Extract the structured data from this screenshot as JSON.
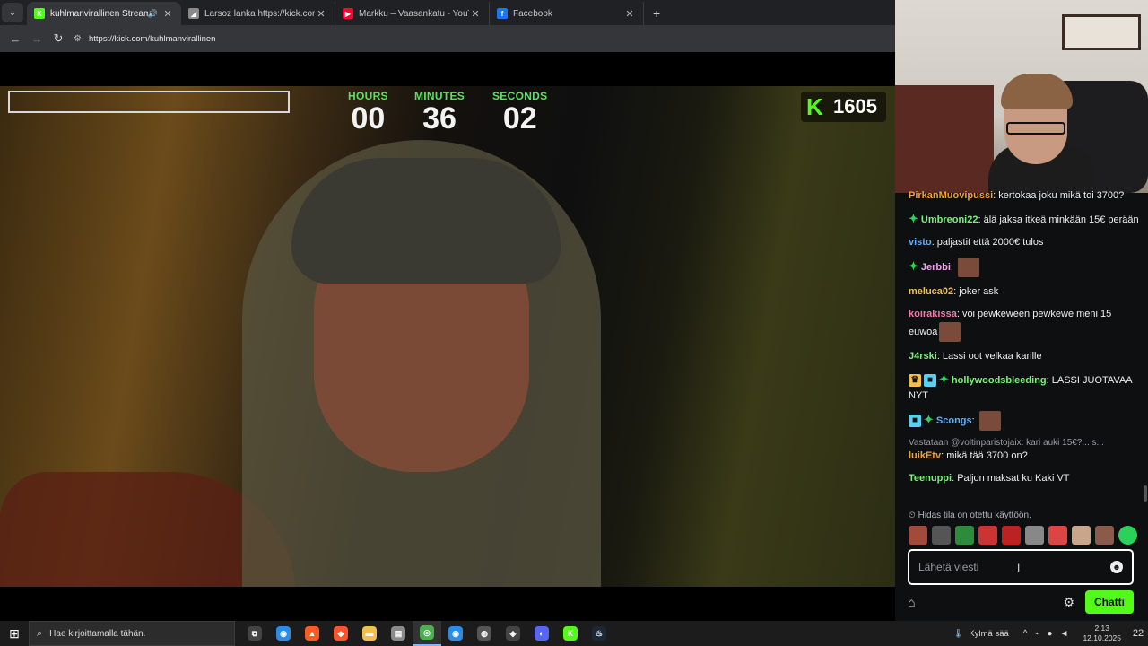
{
  "browser": {
    "tabs": [
      {
        "title": "kuhlmanvirallinen Stream -",
        "favicon": "K",
        "favicon_color": "#53fc18",
        "active": true,
        "has_audio": true
      },
      {
        "title": "Larsoz lanka https://kick.com/la",
        "favicon": "◢",
        "favicon_color": "#8a8a8a",
        "active": false,
        "has_audio": false
      },
      {
        "title": "Markku – Vaasankatu - YouTube",
        "favicon": "▶",
        "favicon_color": "#ff0033",
        "active": false,
        "has_audio": false
      },
      {
        "title": "Facebook",
        "favicon": "f",
        "favicon_color": "#1877f2",
        "active": false,
        "has_audio": false
      }
    ],
    "url": "https://kick.com/kuhlmanvirallinen"
  },
  "stream": {
    "timer": {
      "hours_label": "HOURS",
      "hours": "00",
      "minutes_label": "MINUTES",
      "minutes": "36",
      "seconds_label": "SECONDS",
      "seconds": "02"
    },
    "viewer_badge": {
      "logo": "K",
      "count": "1605"
    },
    "accent_color": "#53fc18"
  },
  "chat": {
    "messages": [
      {
        "user": "PirkanMuovipussi",
        "user_color": "#f2a134",
        "text": ": kertokaa joku mikä toi 3700?",
        "badges": [],
        "emote": false
      },
      {
        "user": "Umbreoni22",
        "user_color": "#7cf07c",
        "text": ": älä jaksa itkeä minkään 15€ perään",
        "badges": [
          "star"
        ],
        "emote": false
      },
      {
        "user": "visto",
        "user_color": "#5ab0ff",
        "text": ": paljastit että 2000€ tulos",
        "badges": [],
        "emote": false
      },
      {
        "user": "Jerbbi",
        "user_color": "#f2a0f0",
        "text": ": ",
        "badges": [
          "star"
        ],
        "emote": true
      },
      {
        "user": "meluca02",
        "user_color": "#f2c04a",
        "text": ": joker ask",
        "badges": [],
        "emote": false
      },
      {
        "user": "koirakissa",
        "user_color": "#f27aa8",
        "text": ": voi pewkeween pewkewe meni 15 euwoa",
        "badges": [],
        "emote": true
      },
      {
        "user": "J4rski",
        "user_color": "#7cf07c",
        "text": ": Lassi oot velkaa karille",
        "badges": [],
        "emote": false
      },
      {
        "user": "hollywoodsbleeding",
        "user_color": "#7cf07c",
        "text": ": LASSI JUOTAVAA NYT",
        "badges": [
          "crown",
          "gift",
          "star"
        ],
        "emote": false
      },
      {
        "user": "Scongs",
        "user_color": "#5ab0ff",
        "text": ": ",
        "badges": [
          "gift",
          "star"
        ],
        "emote": true
      },
      {
        "reply_to": "Vastataan @voltinparistojaix: kari auki 15€?... s...",
        "user": "luikEtv",
        "user_color": "#f2a134",
        "text": ": mikä tää 3700 on?",
        "badges": [],
        "emote": false
      },
      {
        "user": "Teenuppi",
        "user_color": "#7cf07c",
        "text": ": Paljon maksat ku Kaki VT",
        "badges": [],
        "emote": false
      }
    ],
    "slow_mode_text": "Hidas tila on otettu käyttöön.",
    "input_placeholder": "Lähetä viesti",
    "send_label": "Chatti",
    "send_color": "#53fc18"
  },
  "taskbar": {
    "search_placeholder": "Hae kirjoittamalla tähän.",
    "weather": "Kylmä sää",
    "time": "2.13",
    "date": "12.10.2025",
    "notification_count": "22",
    "apps": [
      "task-view-icon",
      "browser-icon",
      "fire-icon",
      "brave-icon",
      "file-explorer-icon",
      "explorer-icon",
      "chrome-icon",
      "edge-icon",
      "obs-icon",
      "unity-icon",
      "discord-icon",
      "kick-icon",
      "steam-icon"
    ]
  }
}
